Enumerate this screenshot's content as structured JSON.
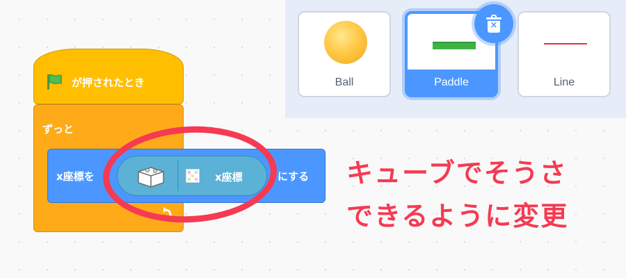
{
  "sprites": [
    {
      "name": "Ball",
      "selected": false
    },
    {
      "name": "Paddle",
      "selected": true
    },
    {
      "name": "Line",
      "selected": false
    }
  ],
  "delete_icon": "trash-icon",
  "script": {
    "hat_block": {
      "icon": "green-flag-icon",
      "label": "が押されたとき"
    },
    "forever_block": {
      "label": "ずっと"
    },
    "set_x_block": {
      "label_prefix": "x座標を",
      "label_suffix": "にする"
    },
    "reporter_block": {
      "icon": "cube-icon",
      "extension_icon": "color-grid-icon",
      "label": "x座標"
    }
  },
  "annotation": {
    "line1": "キューブでそうさ",
    "line2": "できるように変更",
    "color": "#f53a52"
  },
  "colors": {
    "events": "#ffbf00",
    "control": "#ffab19",
    "motion": "#4c97ff",
    "extension": "#5cb1d6",
    "selected": "#4c97ff"
  }
}
